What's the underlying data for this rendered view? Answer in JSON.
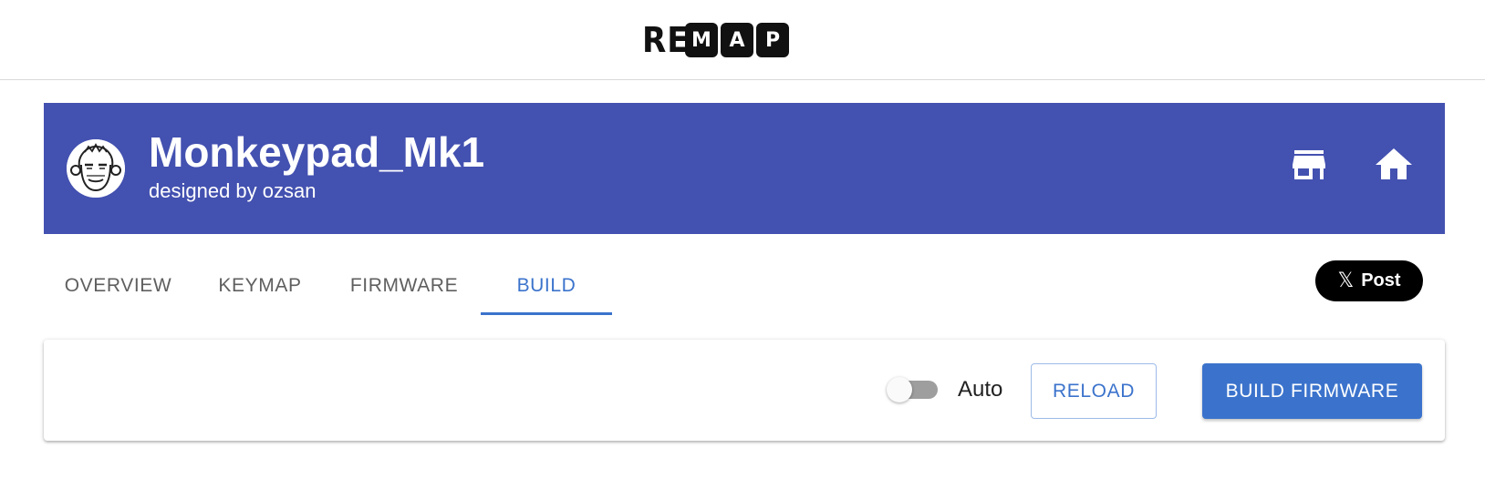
{
  "app": {
    "logo_plain": "RE",
    "logo_boxed": [
      "M",
      "A",
      "P"
    ]
  },
  "keyboard": {
    "name": "Monkeypad_Mk1",
    "designer": "designed by ozsan",
    "header_icons": [
      "store-icon",
      "home-icon"
    ],
    "banner_color": "#4351b0"
  },
  "tabs": [
    {
      "label": "OVERVIEW",
      "active": false
    },
    {
      "label": "KEYMAP",
      "active": false
    },
    {
      "label": "FIRMWARE",
      "active": false
    },
    {
      "label": "BUILD",
      "active": true
    }
  ],
  "share": {
    "icon": "x-logo-icon",
    "label": "Post"
  },
  "build": {
    "auto_toggle": {
      "label": "Auto",
      "checked": false
    },
    "reload_label": "RELOAD",
    "build_label": "BUILD FIRMWARE",
    "accent_color": "#3b73cc"
  }
}
